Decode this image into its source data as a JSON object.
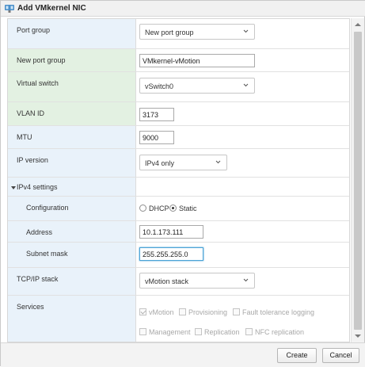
{
  "window": {
    "title": "Add VMkernel NIC",
    "icon": "vmkernel-nic-icon"
  },
  "colors": {
    "label_bg": "#e9f2fa",
    "label_bg_required": "#e3f1e2",
    "focus_border": "#49a2d6"
  },
  "form": {
    "port_group": {
      "label": "Port group",
      "value": "New port group"
    },
    "new_port_group": {
      "label": "New port group",
      "value": "VMkernel-vMotion"
    },
    "virtual_switch": {
      "label": "Virtual switch",
      "value": "vSwitch0"
    },
    "vlan_id": {
      "label": "VLAN ID",
      "value": "3173"
    },
    "mtu": {
      "label": "MTU",
      "value": "9000"
    },
    "ip_version": {
      "label": "IP version",
      "value": "IPv4 only"
    },
    "ipv4_settings": {
      "label": "IPv4 settings",
      "expanded": true,
      "configuration": {
        "label": "Configuration",
        "options": [
          "DHCP",
          "Static"
        ],
        "selected": "Static"
      },
      "address": {
        "label": "Address",
        "value": "10.1.173.111"
      },
      "subnet_mask": {
        "label": "Subnet mask",
        "value": "255.255.255.0"
      }
    },
    "tcpip_stack": {
      "label": "TCP/IP stack",
      "value": "vMotion stack"
    },
    "services": {
      "label": "Services",
      "items": [
        {
          "label": "vMotion",
          "checked": true,
          "disabled": true
        },
        {
          "label": "Provisioning",
          "checked": false,
          "disabled": true
        },
        {
          "label": "Fault tolerance logging",
          "checked": false,
          "disabled": true
        },
        {
          "label": "Management",
          "checked": false,
          "disabled": true
        },
        {
          "label": "Replication",
          "checked": false,
          "disabled": true
        },
        {
          "label": "NFC replication",
          "checked": false,
          "disabled": true
        }
      ]
    }
  },
  "buttons": {
    "create": "Create",
    "cancel": "Cancel"
  }
}
